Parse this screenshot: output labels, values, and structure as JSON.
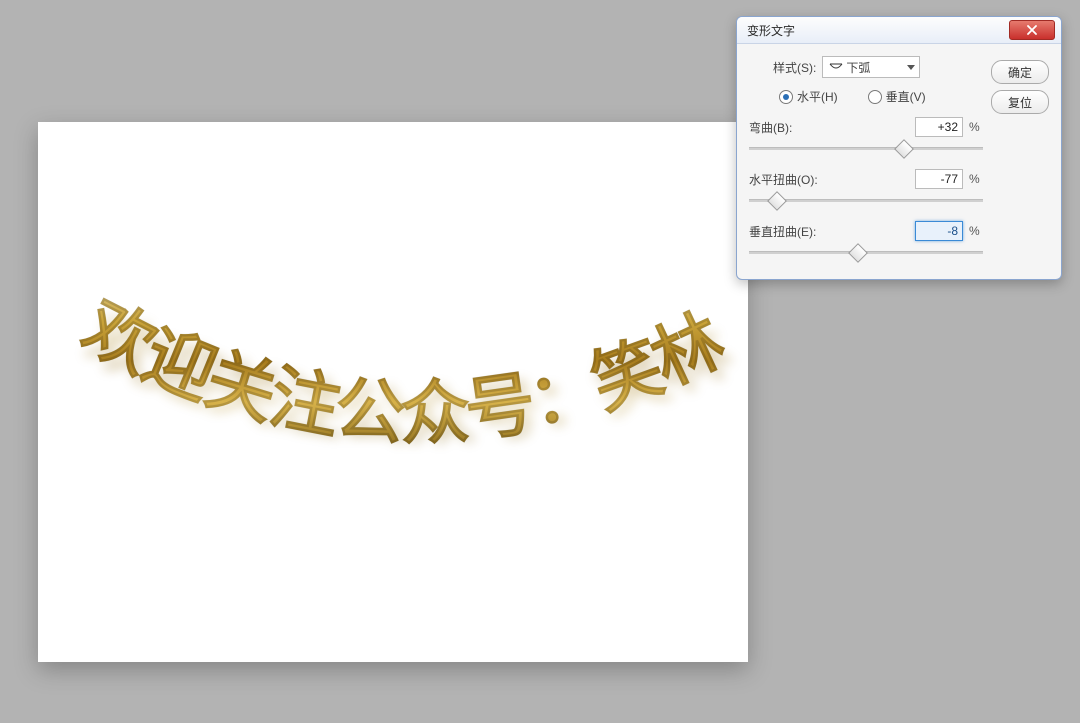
{
  "canvas": {
    "warped_text": "欢迎关注公众号：笑林新语"
  },
  "dialog": {
    "title": "变形文字",
    "close_label": "close",
    "buttons": {
      "ok": "确定",
      "reset": "复位"
    },
    "style": {
      "label": "样式(S):",
      "selected": "下弧"
    },
    "orientation": {
      "horizontal": "水平(H)",
      "vertical": "垂直(V)",
      "checked": "horizontal"
    },
    "sliders": {
      "bend": {
        "label": "弯曲(B):",
        "value": "+32",
        "pos_pct": 66,
        "unit": "%"
      },
      "hdist": {
        "label": "水平扭曲(O):",
        "value": "-77",
        "pos_pct": 11.5,
        "unit": "%"
      },
      "vdist": {
        "label": "垂直扭曲(E):",
        "value": "-8",
        "pos_pct": 46,
        "unit": "%",
        "active": true
      }
    }
  }
}
